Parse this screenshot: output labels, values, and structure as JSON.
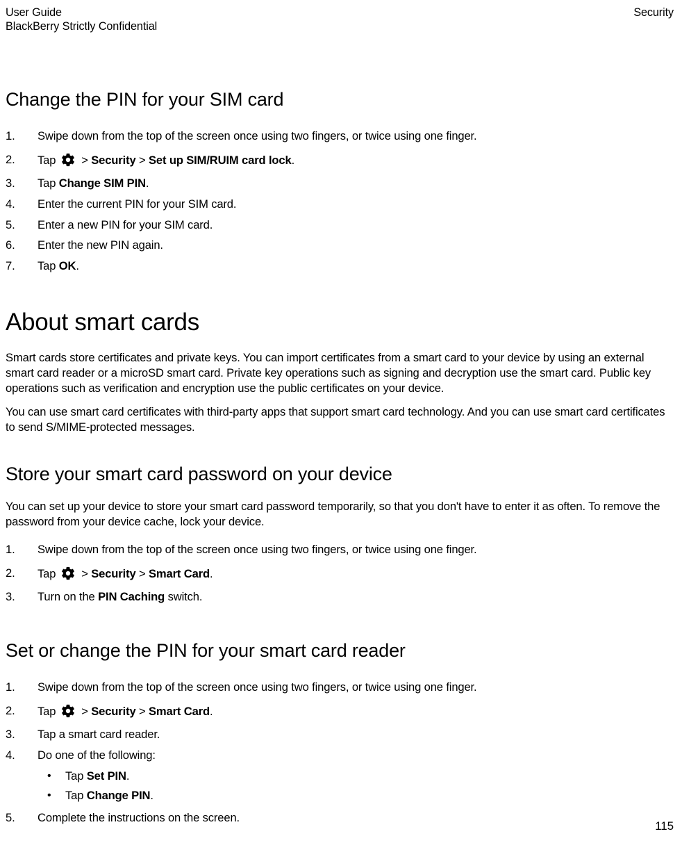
{
  "header": {
    "left_line1": "User Guide",
    "left_line2": "BlackBerry Strictly Confidential",
    "right": "Security"
  },
  "section1": {
    "title": "Change the PIN for your SIM card",
    "steps": [
      "Swipe down from the top of the screen once using two fingers, or twice using one finger.",
      {
        "pre": "Tap ",
        "icon": "gear-icon",
        "post_a": " > ",
        "b1": "Security",
        "mid": " > ",
        "b2": "Set up SIM/RUIM card lock",
        "end": "."
      },
      {
        "pre": "Tap ",
        "b1": "Change SIM PIN",
        "end": "."
      },
      "Enter the current PIN for your SIM card.",
      "Enter a new PIN for your SIM card.",
      "Enter the new PIN again.",
      {
        "pre": "Tap ",
        "b1": "OK",
        "end": "."
      }
    ]
  },
  "section2": {
    "title": "About smart cards",
    "p1": "Smart cards store certificates and private keys. You can import certificates from a smart card to your device by using an external smart card reader or a microSD smart card. Private key operations such as signing and decryption use the smart card. Public key operations such as verification and encryption use the public certificates on your device.",
    "p2": "You can use smart card certificates with third-party apps that support smart card technology. And you can use smart card certificates to send S/MIME-protected messages."
  },
  "section3": {
    "title": "Store your smart card password on your device",
    "p1": "You can set up your device to store your smart card password temporarily, so that you don't have to enter it as often. To remove the password from your device cache, lock your device.",
    "steps": [
      "Swipe down from the top of the screen once using two fingers, or twice using one finger.",
      {
        "pre": "Tap ",
        "icon": "gear-icon",
        "post_a": " > ",
        "b1": "Security",
        "mid": " > ",
        "b2": "Smart Card",
        "end": "."
      },
      {
        "pre": "Turn on the ",
        "b1": "PIN Caching",
        "end": " switch."
      }
    ]
  },
  "section4": {
    "title": "Set or change the PIN for your smart card reader",
    "steps": [
      "Swipe down from the top of the screen once using two fingers, or twice using one finger.",
      {
        "pre": "Tap ",
        "icon": "gear-icon",
        "post_a": " > ",
        "b1": "Security",
        "mid": " > ",
        "b2": "Smart Card",
        "end": "."
      },
      "Tap a smart card reader.",
      "Do one of the following:"
    ],
    "sub": [
      {
        "pre": "Tap ",
        "b1": "Set PIN",
        "end": "."
      },
      {
        "pre": "Tap ",
        "b1": "Change PIN",
        "end": "."
      }
    ],
    "step5": "Complete the instructions on the screen."
  },
  "page_number": "115"
}
